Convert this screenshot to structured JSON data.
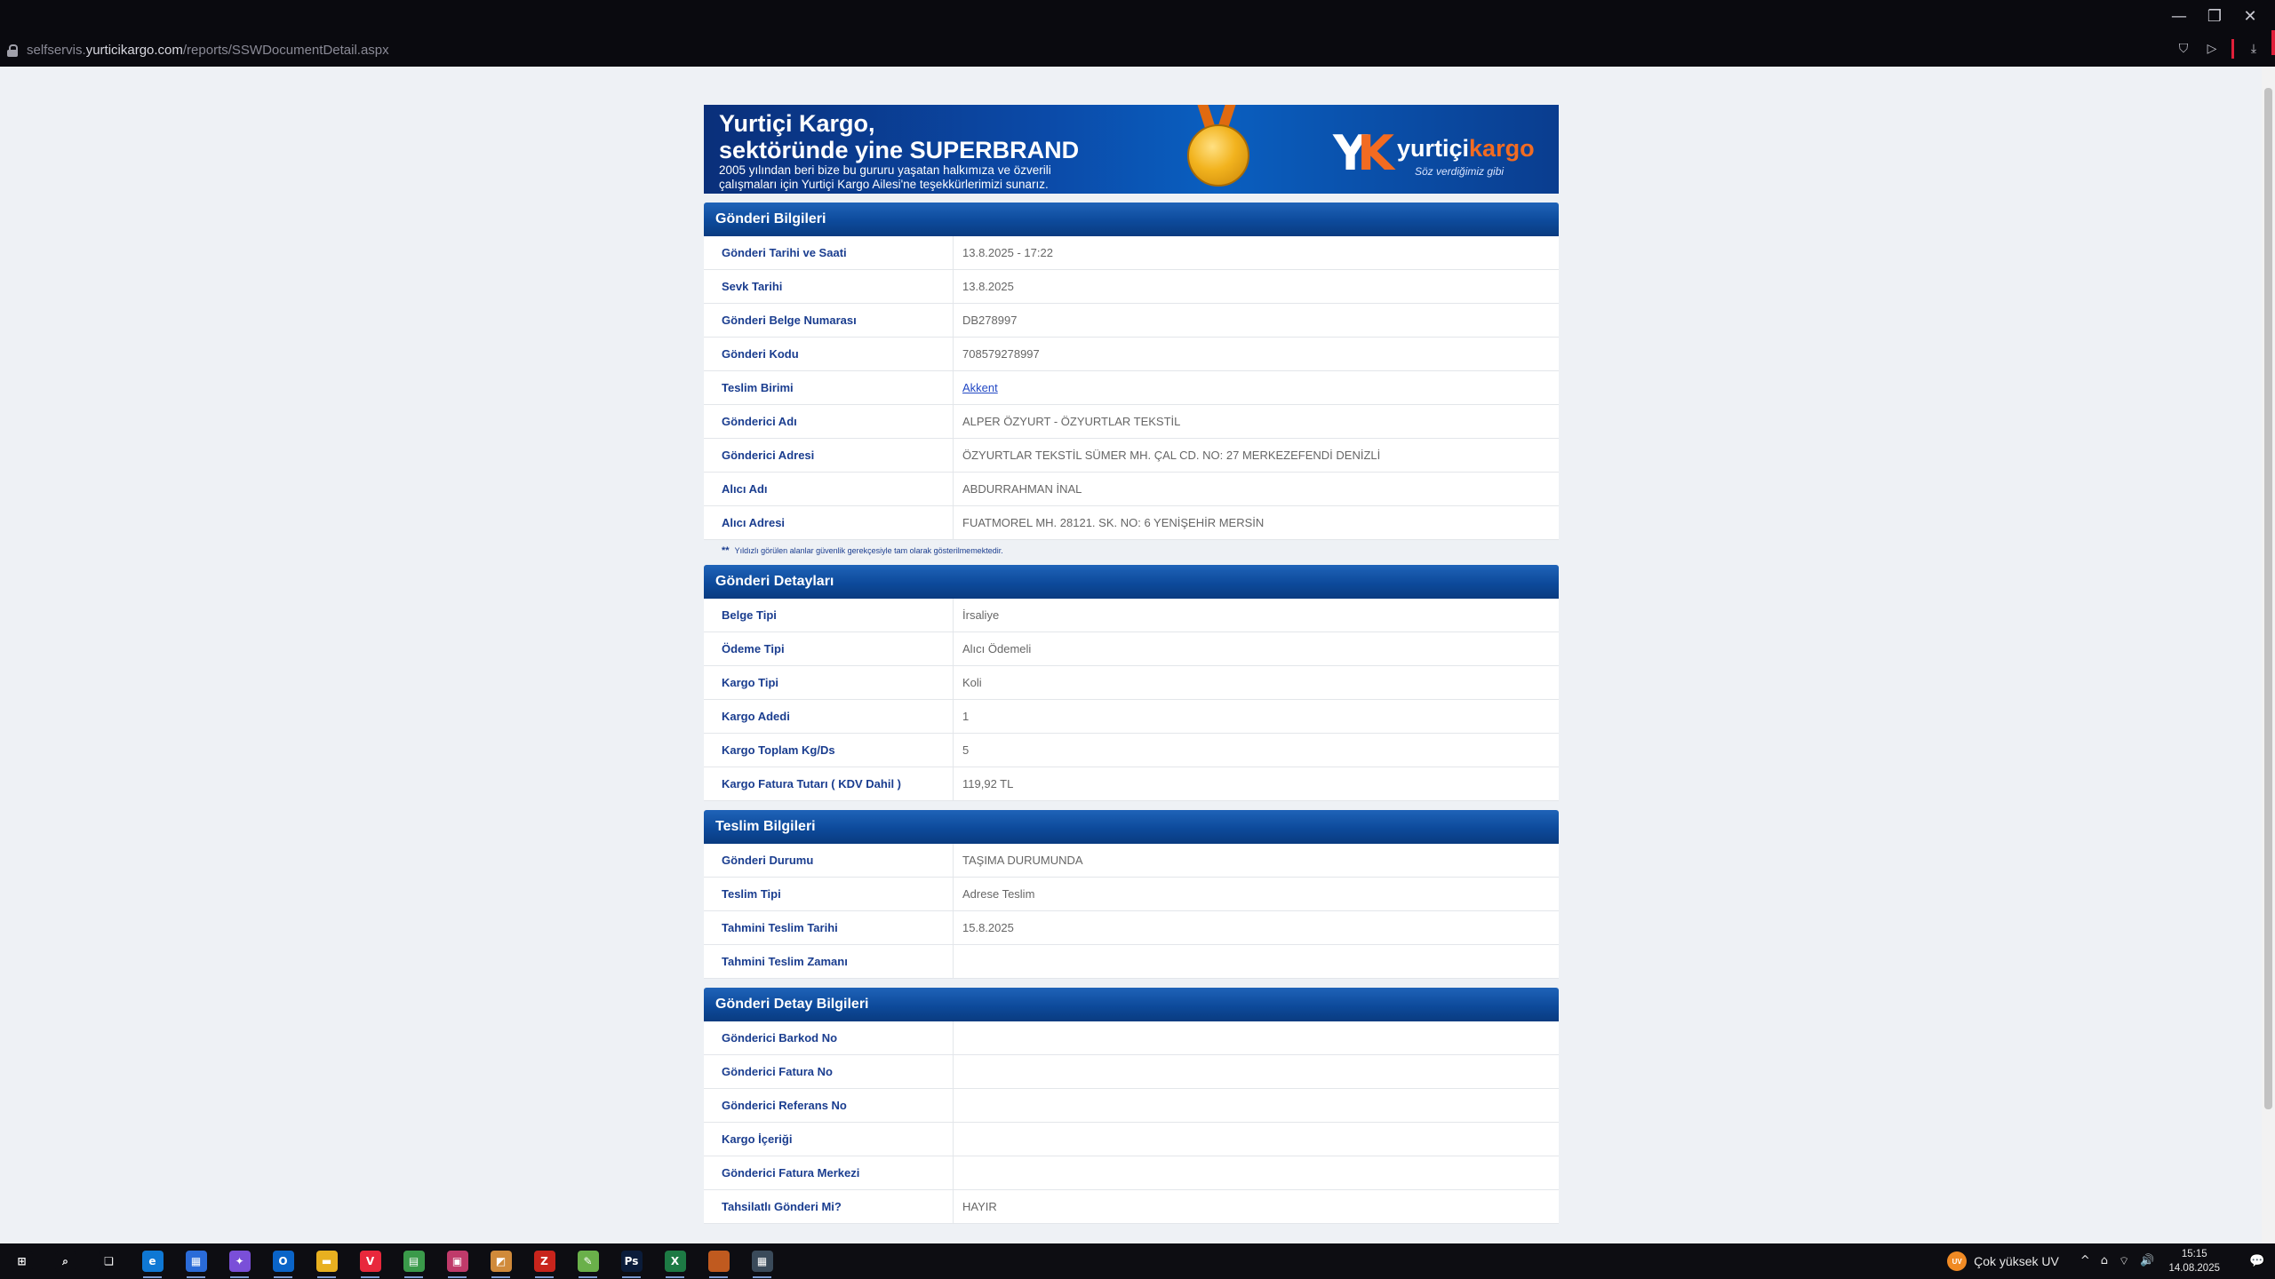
{
  "browser": {
    "url_prefix": "selfservis.",
    "url_domain": "yurticikargo.com",
    "url_path": "/reports/SSWDocumentDetail.aspx",
    "controls": {
      "minimize": "—",
      "restore": "❐",
      "close": "✕"
    },
    "tools": {
      "extensions": "⛉",
      "play": "▷",
      "download": "⤓"
    }
  },
  "banner": {
    "title_line1": "Yurtiçi Kargo,",
    "title_line2": "sektöründe yine SUPERBRAND",
    "sub_line1": "2005 yılından beri bize bu gururu yaşatan halkımıza ve özverili",
    "sub_line2": "çalışmaları için Yurtiçi Kargo Ailesi'ne teşekkürlerimizi sunarız.",
    "logo_word1": "yurtiçi",
    "logo_word2": "kargo",
    "logo_slogan": "Söz verdiğimiz gibi"
  },
  "sections": {
    "gonderi_bilgileri": {
      "title": "Gönderi Bilgileri",
      "rows": [
        {
          "label": "Gönderi Tarihi ve Saati",
          "value": "13.8.2025 - 17:22"
        },
        {
          "label": "Sevk Tarihi",
          "value": "13.8.2025"
        },
        {
          "label": "Gönderi Belge Numarası",
          "value": "DB278997"
        },
        {
          "label": "Gönderi Kodu",
          "value": "708579278997"
        },
        {
          "label": "Teslim Birimi",
          "value": "Akkent"
        },
        {
          "label": "Gönderici Adı",
          "value": "ALPER ÖZYURT - ÖZYURTLAR TEKSTİL"
        },
        {
          "label": "Gönderici Adresi",
          "value": "ÖZYURTLAR TEKSTİL SÜMER MH. ÇAL CD. NO: 27 MERKEZEFENDİ DENİZLİ"
        },
        {
          "label": "Alıcı Adı",
          "value": "ABDURRAHMAN İNAL"
        },
        {
          "label": "Alıcı Adresi",
          "value": "FUATMOREL MH. 28121. SK. NO: 6 YENİŞEHİR MERSİN"
        }
      ],
      "note_mark": "**",
      "note": "Yıldızlı görülen alanlar güvenlik gerekçesiyle tam olarak gösterilmemektedir."
    },
    "gonderi_detaylari": {
      "title": "Gönderi Detayları",
      "rows": [
        {
          "label": "Belge Tipi",
          "value": "İrsaliye"
        },
        {
          "label": "Ödeme Tipi",
          "value": "Alıcı Ödemeli"
        },
        {
          "label": "Kargo Tipi",
          "value": "Koli"
        },
        {
          "label": "Kargo Adedi",
          "value": "1"
        },
        {
          "label": "Kargo Toplam Kg/Ds",
          "value": "5"
        },
        {
          "label": "Kargo Fatura Tutarı ( KDV Dahil )",
          "value": "119,92 TL"
        }
      ]
    },
    "teslim_bilgileri": {
      "title": "Teslim Bilgileri",
      "rows": [
        {
          "label": "Gönderi Durumu",
          "value": "TAŞIMA DURUMUNDA"
        },
        {
          "label": "Teslim Tipi",
          "value": "Adrese Teslim"
        },
        {
          "label": "Tahmini Teslim Tarihi",
          "value": "15.8.2025"
        },
        {
          "label": "Tahmini Teslim Zamanı",
          "value": ""
        }
      ]
    },
    "gonderi_detay_bilgileri": {
      "title": "Gönderi Detay Bilgileri",
      "rows": [
        {
          "label": "Gönderici Barkod No",
          "value": ""
        },
        {
          "label": "Gönderici Fatura No",
          "value": ""
        },
        {
          "label": "Gönderici Referans No",
          "value": ""
        },
        {
          "label": "Kargo İçeriği",
          "value": ""
        },
        {
          "label": "Gönderici Fatura Merkezi",
          "value": ""
        },
        {
          "label": "Tahsilatlı Gönderi Mi?",
          "value": "HAYIR"
        }
      ]
    }
  },
  "taskbar": {
    "icons": [
      {
        "name": "start-icon",
        "glyph": "⊞",
        "color": "#0d0d12"
      },
      {
        "name": "search-icon",
        "glyph": "⌕",
        "color": "#0d0d12"
      },
      {
        "name": "task-view-icon",
        "glyph": "❏",
        "color": "#0d0d12"
      },
      {
        "name": "edge-icon",
        "glyph": "e",
        "color": "#0f78d4"
      },
      {
        "name": "store-icon",
        "glyph": "▦",
        "color": "#2a6bd8"
      },
      {
        "name": "copilot-icon",
        "glyph": "✦",
        "color": "#7a4fd8"
      },
      {
        "name": "outlook-icon",
        "glyph": "O",
        "color": "#0a64c8"
      },
      {
        "name": "file-explorer-icon",
        "glyph": "▬",
        "color": "#e8b020"
      },
      {
        "name": "vivaldi-icon",
        "glyph": "V",
        "color": "#e8283c"
      },
      {
        "name": "notes-app-icon",
        "glyph": "▤",
        "color": "#3a9a4a"
      },
      {
        "name": "calendar-app-icon",
        "glyph": "▣",
        "color": "#c03a6a"
      },
      {
        "name": "photos-app-icon",
        "glyph": "◩",
        "color": "#d08a3a"
      },
      {
        "name": "filezilla-icon",
        "glyph": "Z",
        "color": "#c8241c"
      },
      {
        "name": "notepadpp-icon",
        "glyph": "✎",
        "color": "#6ab04a"
      },
      {
        "name": "photoshop-icon",
        "glyph": "Ps",
        "color": "#0b1c3a"
      },
      {
        "name": "excel-icon",
        "glyph": "X",
        "color": "#1d7a44"
      },
      {
        "name": "active-window-icon",
        "glyph": "",
        "color": "#c05a1f"
      },
      {
        "name": "calculator-icon",
        "glyph": "▦",
        "color": "#3a4a5a"
      }
    ],
    "uv_badge": "UV",
    "uv_text": "Çok yüksek UV",
    "tray_icons": {
      "chevron": "^",
      "network": "⌂",
      "wifi": "⌔",
      "volume": "🔊"
    },
    "time": "15:15",
    "date": "14.08.2025",
    "notification_glyph": "💬"
  }
}
